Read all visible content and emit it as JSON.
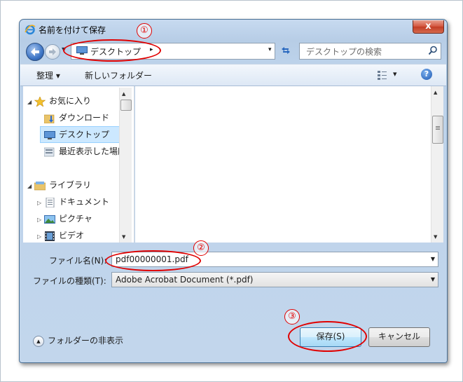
{
  "window": {
    "title": "名前を付けて保存",
    "close_label": "x"
  },
  "address": {
    "location": "デスクトップ",
    "arrow": "▸",
    "dropdown": "▾"
  },
  "search": {
    "placeholder": "デスクトップの検索"
  },
  "toolbar": {
    "organize_label": "整理 ▾",
    "new_folder_label": "新しいフォルダー",
    "view_dropdown": "▾",
    "help_label": "?"
  },
  "sidebar": {
    "items": [
      {
        "label": "お気に入り",
        "icon": "star-icon",
        "expander": "◢"
      },
      {
        "label": "ダウンロード",
        "icon": "download-folder-icon"
      },
      {
        "label": "デスクトップ",
        "icon": "desktop-icon",
        "selected": true
      },
      {
        "label": "最近表示した場所",
        "icon": "recent-places-icon"
      },
      {
        "label": "ライブラリ",
        "icon": "library-icon",
        "expander": "◢"
      },
      {
        "label": "ドキュメント",
        "icon": "documents-icon",
        "expander": "▷"
      },
      {
        "label": "ピクチャ",
        "icon": "pictures-icon",
        "expander": "▷"
      },
      {
        "label": "ビデオ",
        "icon": "videos-icon",
        "expander": "▷"
      }
    ]
  },
  "form": {
    "filename_label": "ファイル名(N):",
    "filename_value": "pdf00000001.pdf",
    "filetype_label": "ファイルの種類(T):",
    "filetype_value": "Adobe Acrobat Document (*.pdf)"
  },
  "footer": {
    "hide_folders_label": "フォルダーの非表示",
    "save_label": "保存(S)",
    "cancel_label": "キャンセル"
  },
  "annotations": [
    "①",
    "②",
    "③"
  ],
  "colors": {
    "annotation": "#e00000",
    "selection": "#cce8ff"
  }
}
